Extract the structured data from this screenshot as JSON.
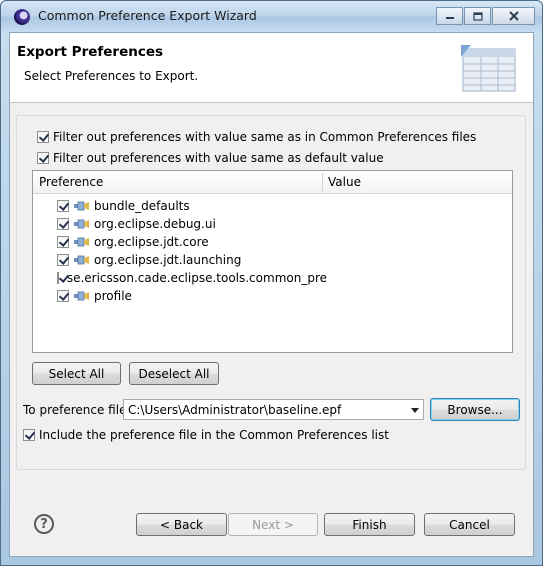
{
  "window": {
    "title": "Common Preference Export Wizard"
  },
  "header": {
    "title": "Export Preferences",
    "description": "Select Preferences to Export."
  },
  "options": {
    "filter_common": "Filter out preferences with value same as in Common Preferences files",
    "filter_default": "Filter out preferences with value same as default value"
  },
  "table": {
    "columns": [
      "Preference",
      "Value"
    ],
    "rows": [
      {
        "label": "bundle_defaults",
        "checked": true
      },
      {
        "label": "org.eclipse.debug.ui",
        "checked": true
      },
      {
        "label": "org.eclipse.jdt.core",
        "checked": true
      },
      {
        "label": "org.eclipse.jdt.launching",
        "checked": true
      },
      {
        "label": "se.ericsson.cade.eclipse.tools.common_pre",
        "checked": true
      },
      {
        "label": "profile",
        "checked": true
      }
    ]
  },
  "selection_buttons": {
    "select_all": "Select All",
    "deselect_all": "Deselect All"
  },
  "file": {
    "label": "To preference file:",
    "value": "C:\\Users\\Administrator\\baseline.epf",
    "browse": "Browse..."
  },
  "include": {
    "label": "Include the preference file in the Common Preferences list",
    "checked": true
  },
  "footer": {
    "back": "< Back",
    "next": "Next >",
    "finish": "Finish",
    "cancel": "Cancel"
  }
}
